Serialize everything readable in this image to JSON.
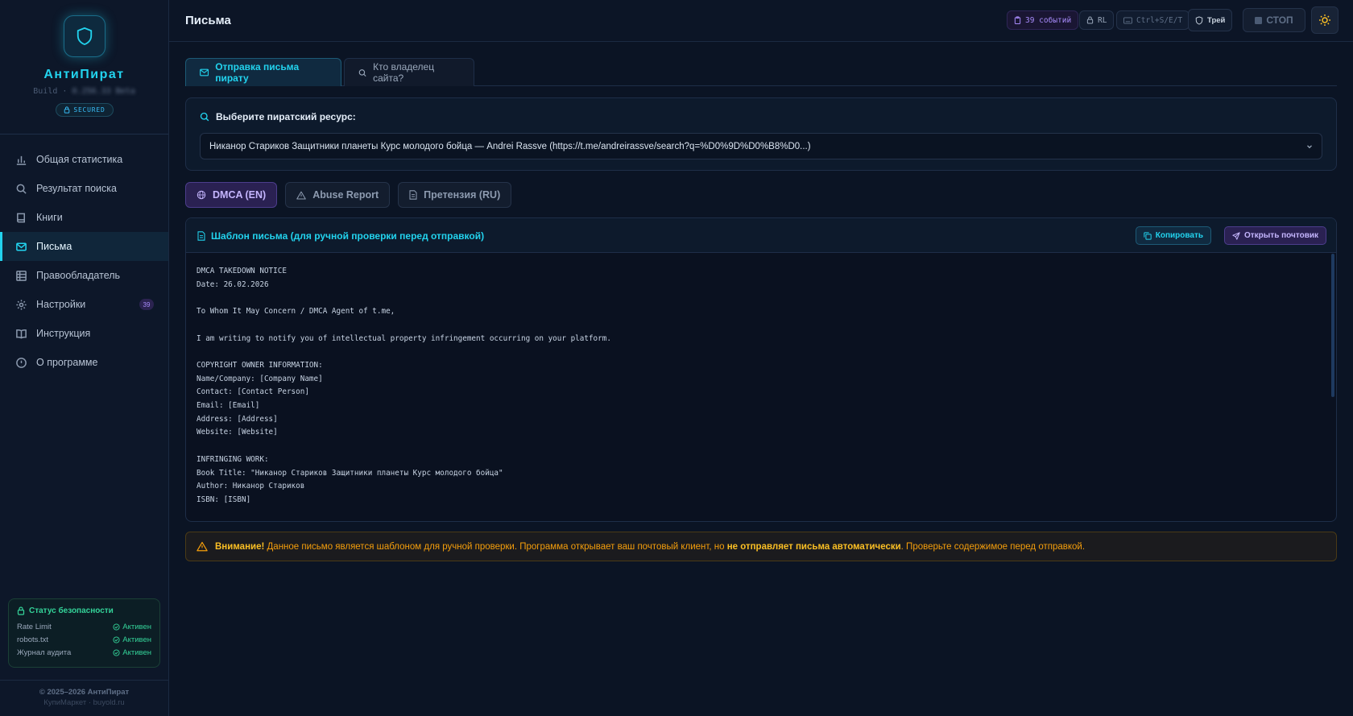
{
  "app": {
    "name": "АнтиПират",
    "build_label": "Build ·",
    "build_version": "0.256.33 Beta",
    "secured": "SECURED"
  },
  "nav": {
    "items": [
      {
        "label": "Общая статистика",
        "icon": "bar-chart-icon"
      },
      {
        "label": "Результат поиска",
        "icon": "search-icon"
      },
      {
        "label": "Книги",
        "icon": "book-icon"
      },
      {
        "label": "Письма",
        "icon": "mail-icon",
        "active": true
      },
      {
        "label": "Правообладатель",
        "icon": "table-icon"
      },
      {
        "label": "Настройки",
        "icon": "gear-icon",
        "badge": "39"
      },
      {
        "label": "Инструкция",
        "icon": "open-book-icon"
      },
      {
        "label": "О программе",
        "icon": "info-icon"
      }
    ]
  },
  "security": {
    "title": "Статус безопасности",
    "rows": [
      {
        "label": "Rate Limit",
        "status": "Активен"
      },
      {
        "label": "robots.txt",
        "status": "Активен"
      },
      {
        "label": "Журнал аудита",
        "status": "Активен"
      }
    ]
  },
  "footer": {
    "copyright": "© 2025–2026 АнтиПират",
    "site": "КупиМаркет · buyold.ru"
  },
  "topbar": {
    "title": "Письма",
    "events": "39 событий",
    "rl": "RL",
    "shortcut": "Ctrl+S/E/T",
    "tray": "Трей",
    "stop": "СТОП"
  },
  "tabs": {
    "send": "Отправка письма пирату",
    "owner": "Кто владелец сайта?"
  },
  "selector": {
    "label": "Выберите пиратский ресурс:",
    "value": "Никанор Стариков Защитники планеты Курс молодого бойца — Andrei Rassve (https://t.me/andreirassve/search?q=%D0%9D%D0%B8%D0...)"
  },
  "letter_types": {
    "dmca": "DMCA (EN)",
    "abuse": "Abuse Report",
    "claim": "Претензия (RU)"
  },
  "letter": {
    "title": "Шаблон письма (для ручной проверки перед отправкой)",
    "copy_button": "Копировать",
    "mail_button": "Открыть почтовик",
    "body": "DMCA TAKEDOWN NOTICE\nDate: 26.02.2026\n\nTo Whom It May Concern / DMCA Agent of t.me,\n\nI am writing to notify you of intellectual property infringement occurring on your platform.\n\nCOPYRIGHT OWNER INFORMATION:\nName/Company: [Company Name]\nContact: [Contact Person]\nEmail: [Email]\nAddress: [Address]\nWebsite: [Website]\n\nINFRINGING WORK:\nBook Title: \"Никанор Стариков Защитники планеты Курс молодого бойца\"\nAuthor: Никанор Стариков\nISBN: [ISBN]"
  },
  "warning": {
    "strong": "Внимание!",
    "text1": " Данное письмо является шаблоном для ручной проверки. Программа открывает ваш почтовый клиент, но ",
    "strong2": "не отправляет письма автоматически",
    "text2": ". Проверьте содержимое перед отправкой."
  },
  "colors": {
    "accent": "#22d3ee",
    "purple": "#a78bfa",
    "success": "#34d399",
    "warning": "#f59e0b"
  }
}
